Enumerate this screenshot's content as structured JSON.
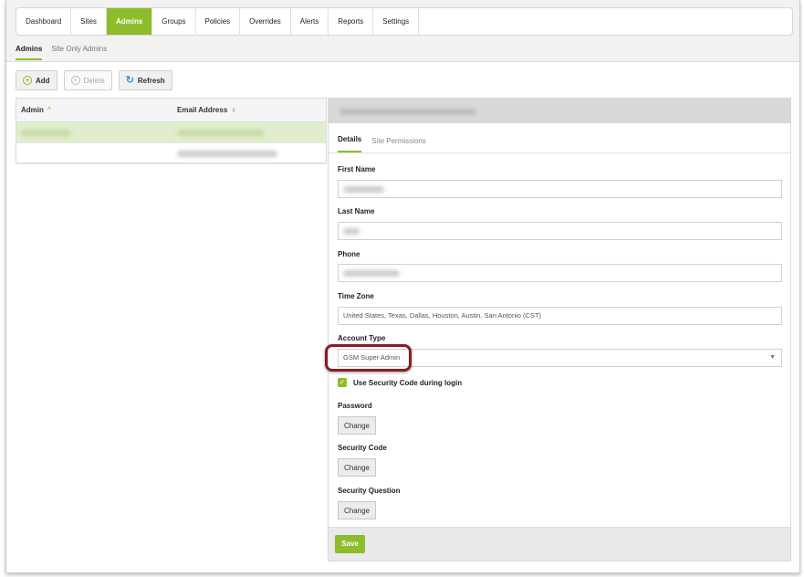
{
  "nav": {
    "items": [
      "Dashboard",
      "Sites",
      "Admins",
      "Groups",
      "Policies",
      "Overrides",
      "Alerts",
      "Reports",
      "Settings"
    ],
    "active": "Admins"
  },
  "subnav": {
    "items": [
      "Admins",
      "Site Only Admins"
    ],
    "active": "Admins"
  },
  "toolbar": {
    "add_label": "Add",
    "delete_label": "Delete",
    "refresh_label": "Refresh"
  },
  "grid": {
    "columns": [
      "Admin",
      "Email Address"
    ],
    "sort_indicator_admin": "^",
    "sort_indicator_email": "⇕"
  },
  "details": {
    "tabs": [
      "Details",
      "Site Permissions"
    ],
    "active_tab": "Details",
    "labels": {
      "first_name": "First Name",
      "last_name": "Last Name",
      "phone": "Phone",
      "time_zone": "Time Zone",
      "account_type": "Account Type",
      "security_code_checkbox": "Use Security Code during login",
      "password": "Password",
      "security_code": "Security Code",
      "security_question": "Security Question"
    },
    "values": {
      "time_zone": "United States, Texas, Dallas, Houston, Austin, San Antonio (CST)",
      "account_type": "GSM Super Admin"
    },
    "change_label": "Change",
    "save_label": "Save",
    "security_code_checked": true
  },
  "colors": {
    "accent": "#8dbd2b",
    "highlight": "#8b1b24"
  }
}
